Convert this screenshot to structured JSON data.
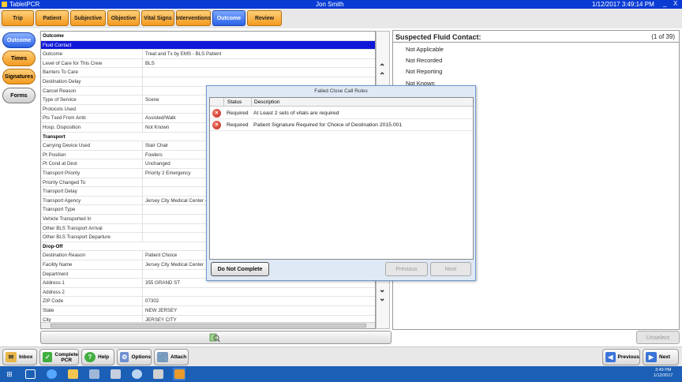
{
  "window": {
    "app_title": "TabletPCR",
    "user": "Jon Smith",
    "datetime": "1/12/2017 3:49:14 PM",
    "minimize": "_",
    "close": "X"
  },
  "tabs": [
    {
      "label": "Trip"
    },
    {
      "label": "Patient"
    },
    {
      "label": "Subjective"
    },
    {
      "label": "Objective"
    },
    {
      "label": "Vital Signs"
    },
    {
      "label": "Interventions"
    },
    {
      "label": "Outcome"
    },
    {
      "label": "Review"
    }
  ],
  "side_nav": [
    {
      "label": "Outcome"
    },
    {
      "label": "Times"
    },
    {
      "label": "Signatures"
    },
    {
      "label": "Forms"
    }
  ],
  "form_rows": [
    {
      "label": "Outcome",
      "value": ""
    },
    {
      "label": "Fluid Contact",
      "value": ""
    },
    {
      "label": "Outcome",
      "value": "Treat and Tx by EMS - BLS Patient"
    },
    {
      "label": "Level of Care for This Crew",
      "value": "BLS"
    },
    {
      "label": "Barriers To Care",
      "value": ""
    },
    {
      "label": "Destination Delay",
      "value": ""
    },
    {
      "label": "Cancel Reason",
      "value": ""
    },
    {
      "label": "Type of Service",
      "value": "Scene"
    },
    {
      "label": "Protocols Used",
      "value": ""
    },
    {
      "label": "Pts Txed From Amb",
      "value": "Assisted/Walk"
    },
    {
      "label": "Hosp. Disposition",
      "value": "Not Known"
    },
    {
      "label": "Transport",
      "value": ""
    },
    {
      "label": "Carrying Device Used",
      "value": "Stair Chair"
    },
    {
      "label": "Pt Position",
      "value": "Fowlers"
    },
    {
      "label": "Pt Cond at Dest",
      "value": "Unchanged"
    },
    {
      "label": "Transport Priority",
      "value": "Priority 2 Emergency"
    },
    {
      "label": "Priority Changed To",
      "value": ""
    },
    {
      "label": "Transport Delay",
      "value": ""
    },
    {
      "label": "Transport Agency",
      "value": "Jersey City Medical Center - "
    },
    {
      "label": "Transport Type",
      "value": ""
    },
    {
      "label": "Vehicle Transported In",
      "value": ""
    },
    {
      "label": "Other BLS Transport Arrival",
      "value": ""
    },
    {
      "label": "Other BLS Transport Departure",
      "value": ""
    },
    {
      "label": "Drop-Off",
      "value": ""
    },
    {
      "label": "Destination Reason",
      "value": "Patient Choice"
    },
    {
      "label": "Facility Name",
      "value": "Jersey City Medical Center"
    },
    {
      "label": "Department",
      "value": ""
    },
    {
      "label": "Address 1",
      "value": "355 GRAND ST"
    },
    {
      "label": "Address 2",
      "value": ""
    },
    {
      "label": "ZIP Code",
      "value": "07302"
    },
    {
      "label": "State",
      "value": "NEW JERSEY"
    },
    {
      "label": "City",
      "value": "JERSEY CITY"
    }
  ],
  "right_panel": {
    "title": "Suspected Fluid Contact:",
    "count": "(1 of 39)",
    "items": [
      "Not Applicable",
      "Not Recorded",
      "Not Reporting",
      "Not Known"
    ],
    "unselect": "Unselect"
  },
  "dialog": {
    "title": "Failed Close Call Rules",
    "col_status": "Status",
    "col_description": "Description",
    "rows": [
      {
        "status": "Required",
        "description": "At Least 2 sets of vitals are required"
      },
      {
        "status": "Required",
        "description": "Patient Signature Required for Choice of Destination 2015.001"
      }
    ],
    "do_not_complete": "Do Not Complete",
    "previous": "Previous",
    "next": "Next"
  },
  "toolbar": {
    "inbox": "Inbox",
    "complete_1": "Complete",
    "complete_2": "PCR",
    "help": "Help",
    "options": "Options",
    "attach": "Attach",
    "previous": "Previous",
    "next": "Next"
  },
  "taskbar": {
    "time": "3:49 PM",
    "date": "1/12/2017"
  },
  "colors": {
    "title_blue": "#0a3cd4",
    "tab_orange": "#f39a1e",
    "tab_active_blue": "#2c63e8",
    "selected_row": "#1018d8",
    "error_red": "#c0281a",
    "taskbar": "#1c5fb6"
  }
}
